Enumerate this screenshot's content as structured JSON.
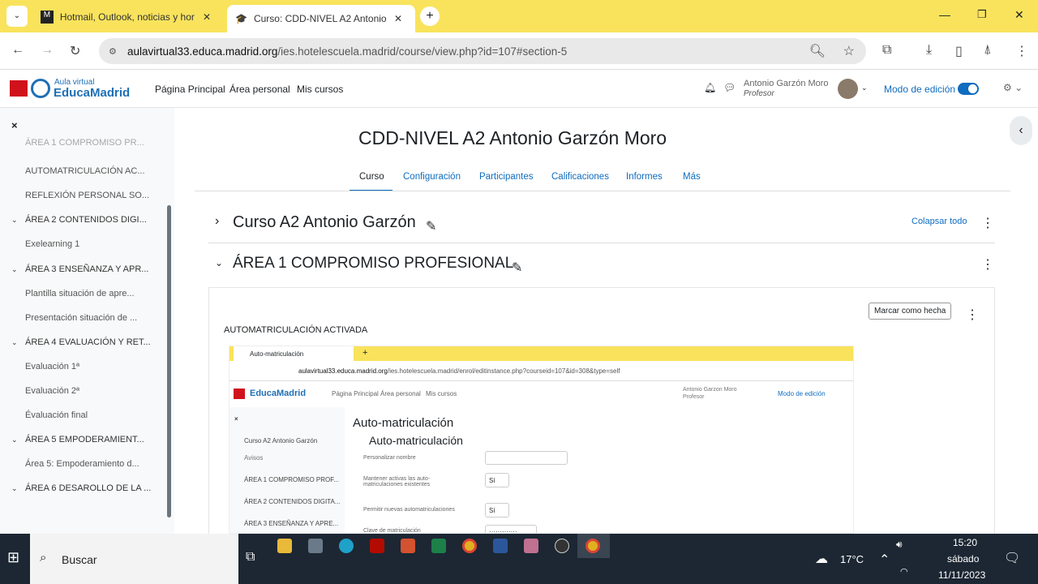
{
  "browser": {
    "tabs": [
      {
        "label": "Hotmail, Outlook, noticias y hor"
      },
      {
        "label": "Curso: CDD-NIVEL A2 Antonio"
      }
    ],
    "url_host": "aulavirtual33.educa.madrid.org",
    "url_path": "/ies.hotelescuela.madrid/course/view.php?id=107#section-5"
  },
  "header": {
    "logo_top": "Aula virtual",
    "logo_main": "EducaMadrid",
    "nav": [
      "Página Principal",
      "Área personal",
      "Mis cursos"
    ],
    "user_name": "Antonio Garzón Moro",
    "user_role": "Profesor",
    "edit_mode_label": "Modo de edición",
    "edit_mode_on": true
  },
  "sidebar": {
    "items": [
      {
        "type": "item",
        "label": "ÁREA 1 COMPROMISO PR..."
      },
      {
        "type": "item",
        "label": "AUTOMATRICULACIÓN AC..."
      },
      {
        "type": "item",
        "label": "REFLEXIÓN PERSONAL SO..."
      },
      {
        "type": "section",
        "label": "ÁREA 2 CONTENIDOS DIGI..."
      },
      {
        "type": "item",
        "label": "Exelearning 1"
      },
      {
        "type": "section",
        "label": "ÁREA 3 ENSEÑANZA Y APR..."
      },
      {
        "type": "item",
        "label": "Plantilla situación de apre..."
      },
      {
        "type": "item",
        "label": "Presentación situación de ..."
      },
      {
        "type": "section",
        "label": "ÁREA 4 EVALUACIÓN Y RET..."
      },
      {
        "type": "item",
        "label": "Evaluación 1ª"
      },
      {
        "type": "item",
        "label": "Evaluación 2ª"
      },
      {
        "type": "item",
        "label": "Évaluación final"
      },
      {
        "type": "section",
        "label": "ÁREA 5 EMPODERAMIENT..."
      },
      {
        "type": "item",
        "label": "Área 5: Empoderamiento d..."
      },
      {
        "type": "section",
        "label": "ÁREA 6 DESAROLLO DE LA ..."
      }
    ]
  },
  "main": {
    "title": "CDD-NIVEL A2 Antonio Garzón Moro",
    "tabs": [
      "Curso",
      "Configuración",
      "Participantes",
      "Calificaciones",
      "Informes",
      "Más"
    ],
    "section0": "Curso A2 Antonio Garzón",
    "collapse_all": "Colapsar todo",
    "section1": "ÁREA 1 COMPROMISO PROFESIONAL",
    "mark_done": "Marcar como hecha",
    "activity_label": "AUTOMATRICULACIÓN  ACTIVADA"
  },
  "embedded": {
    "tab": "Auto-matriculación",
    "url_host": "aulavirtual33.educa.madrid.org",
    "url_path": "/ies.hotelescuela.madrid/enrol/editinstance.php?courseid=107&id=308&type=self",
    "nav": [
      "Página Principal",
      "Área personal",
      "Mis cursos"
    ],
    "user_name": "Antonio Garzon Moro",
    "user_role": "Profesor",
    "edit_mode": "Modo de edición",
    "side": [
      "Curso A2 Antonio Garzón",
      "Avisos",
      "ÁREA 1 COMPROMISO PROF...",
      "ÁREA 2 CONTENIDOS DIGITA...",
      "ÁREA 3 ENSEÑANZA Y APRE..."
    ],
    "h1": "Auto-matriculación",
    "h2": "Auto-matriculación",
    "fields": [
      {
        "label": "Personalizar nombre",
        "value": ""
      },
      {
        "label": "Mantener activas las auto-matriculaciones existentes",
        "value": "Sí"
      },
      {
        "label": "Permitir nuevas automatriculaciones",
        "value": "Sí"
      },
      {
        "label": "Clave de matriculación",
        "value": "·············"
      }
    ]
  },
  "taskbar": {
    "search": "Buscar",
    "temp": "17°C",
    "time": "15:20",
    "day": "sábado",
    "date": "11/11/2023"
  },
  "colors": {
    "accent": "#0f6cbf",
    "tabbar": "#f9e35c",
    "taskbar": "#1c2733"
  }
}
